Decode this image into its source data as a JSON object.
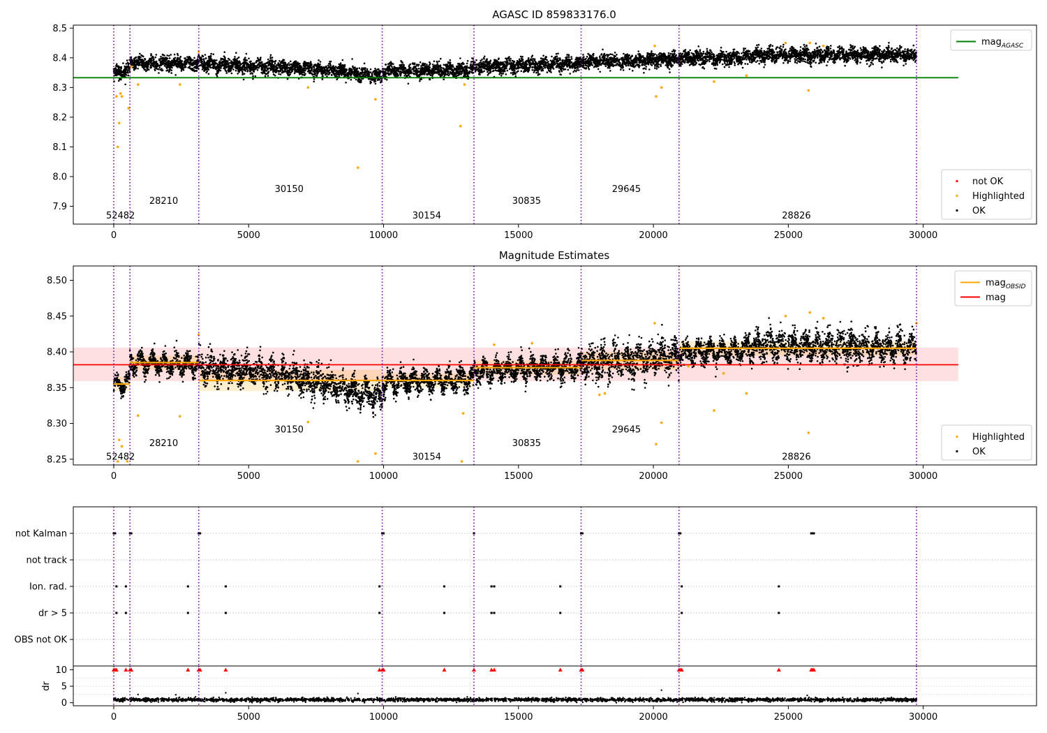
{
  "chart_data": [
    {
      "type": "scatter",
      "title": "AGASC ID 859833176.0",
      "xlabel": "",
      "ylabel": "",
      "xlim": [
        -1500,
        34200
      ],
      "ylim": [
        7.84,
        8.51
      ],
      "xticks": [
        0,
        5000,
        10000,
        15000,
        20000,
        25000,
        30000
      ],
      "yticks": [
        7.9,
        8.0,
        8.1,
        8.2,
        8.3,
        8.4,
        8.5
      ],
      "vlines": [
        0,
        600,
        3150,
        9950,
        13350,
        17320,
        20950,
        29750
      ],
      "obs_labels": [
        {
          "text": "52482",
          "x": 250,
          "y": 7.87
        },
        {
          "text": "28210",
          "x": 1850,
          "y": 7.92
        },
        {
          "text": "30150",
          "x": 6500,
          "y": 7.96
        },
        {
          "text": "30154",
          "x": 11600,
          "y": 7.87
        },
        {
          "text": "30835",
          "x": 15300,
          "y": 7.92
        },
        {
          "text": "29645",
          "x": 19000,
          "y": 7.96
        },
        {
          "text": "28826",
          "x": 25300,
          "y": 7.87
        }
      ],
      "series": [
        {
          "name": "mag_AGASC",
          "kind": "hline",
          "y": 8.333,
          "x_range": [
            -1500,
            31300
          ],
          "color": "#008000"
        },
        {
          "name": "not OK",
          "kind": "points",
          "color": "#ff0000",
          "points": []
        },
        {
          "name": "Highlighted",
          "kind": "points",
          "color": "#ffa500",
          "points": [
            [
              100,
              8.27
            ],
            [
              150,
              8.1
            ],
            [
              200,
              8.18
            ],
            [
              250,
              8.28
            ],
            [
              300,
              8.27
            ],
            [
              550,
              8.23
            ],
            [
              650,
              8.37
            ],
            [
              900,
              8.31
            ],
            [
              2450,
              8.31
            ],
            [
              7200,
              8.3
            ],
            [
              9050,
              8.03
            ],
            [
              9700,
              8.26
            ],
            [
              12850,
              8.17
            ],
            [
              13000,
              8.31
            ],
            [
              20100,
              8.27
            ],
            [
              20300,
              8.3
            ],
            [
              22250,
              8.32
            ],
            [
              23450,
              8.34
            ],
            [
              25750,
              8.29
            ],
            [
              3150,
              8.42
            ],
            [
              20050,
              8.44
            ],
            [
              25800,
              8.45
            ],
            [
              26300,
              8.44
            ],
            [
              24900,
              8.45
            ]
          ]
        },
        {
          "name": "OK",
          "kind": "bands",
          "color": "#000000",
          "segments": [
            {
              "x": [
                0,
                600
              ],
              "y": [
                8.35,
                8.36
              ]
            },
            {
              "x": [
                600,
                3150
              ],
              "y": [
                8.385,
                8.38
              ]
            },
            {
              "x": [
                3150,
                8000
              ],
              "y": [
                8.38,
                8.36
              ]
            },
            {
              "x": [
                8000,
                9950
              ],
              "y": [
                8.36,
                8.335
              ]
            },
            {
              "x": [
                9950,
                13350
              ],
              "y": [
                8.355,
                8.36
              ]
            },
            {
              "x": [
                13350,
                17320
              ],
              "y": [
                8.37,
                8.38
              ]
            },
            {
              "x": [
                17320,
                20950
              ],
              "y": [
                8.385,
                8.395
              ]
            },
            {
              "x": [
                20950,
                23500
              ],
              "y": [
                8.4,
                8.4
              ]
            },
            {
              "x": [
                23500,
                29750
              ],
              "y": [
                8.41,
                8.41
              ]
            }
          ],
          "half_width": 0.025
        }
      ],
      "legends": [
        {
          "position": "top-right",
          "entries": [
            {
              "label": "mag",
              "sub": "AGASC",
              "marker": "line",
              "color": "#008000"
            }
          ]
        },
        {
          "position": "bottom-right",
          "entries": [
            {
              "label": "not OK",
              "marker": "dot",
              "color": "#ff0000"
            },
            {
              "label": "Highlighted",
              "marker": "dot",
              "color": "#ffa500"
            },
            {
              "label": "OK",
              "marker": "dot",
              "color": "#000000"
            }
          ]
        }
      ]
    },
    {
      "type": "scatter",
      "title": "Magnitude Estimates",
      "xlabel": "",
      "ylabel": "",
      "xlim": [
        -1500,
        34200
      ],
      "ylim": [
        8.242,
        8.52
      ],
      "xticks": [
        0,
        5000,
        10000,
        15000,
        20000,
        25000,
        30000
      ],
      "yticks": [
        8.25,
        8.3,
        8.35,
        8.4,
        8.45,
        8.5
      ],
      "vlines": [
        0,
        600,
        3150,
        9950,
        13350,
        17320,
        20950,
        29750
      ],
      "obs_labels": [
        {
          "text": "52482",
          "x": 250,
          "y": 8.254
        },
        {
          "text": "28210",
          "x": 1850,
          "y": 8.273
        },
        {
          "text": "30150",
          "x": 6500,
          "y": 8.292
        },
        {
          "text": "30154",
          "x": 11600,
          "y": 8.254
        },
        {
          "text": "30835",
          "x": 15300,
          "y": 8.273
        },
        {
          "text": "29645",
          "x": 19000,
          "y": 8.292
        },
        {
          "text": "28826",
          "x": 25300,
          "y": 8.254
        }
      ],
      "mag": {
        "value": 8.382,
        "band": [
          8.359,
          8.406
        ],
        "x_range": [
          -1500,
          31300
        ],
        "color": "#ff0000"
      },
      "mag_obsid": [
        {
          "x": [
            0,
            600
          ],
          "value": 8.355,
          "band": [
            8.345,
            8.365
          ]
        },
        {
          "x": [
            600,
            3150
          ],
          "value": 8.385,
          "band": [
            8.375,
            8.395
          ]
        },
        {
          "x": [
            3150,
            9950
          ],
          "value": 8.36,
          "band": [
            8.345,
            8.375
          ]
        },
        {
          "x": [
            9950,
            13350
          ],
          "value": 8.36,
          "band": [
            8.35,
            8.37
          ]
        },
        {
          "x": [
            13350,
            17320
          ],
          "value": 8.378,
          "band": [
            8.368,
            8.388
          ]
        },
        {
          "x": [
            17320,
            20950
          ],
          "value": 8.388,
          "band": [
            8.375,
            8.4
          ]
        },
        {
          "x": [
            20950,
            29750
          ],
          "value": 8.405,
          "band": [
            8.395,
            8.415
          ]
        }
      ],
      "ok_segments": [
        {
          "x": [
            0,
            600
          ],
          "y": [
            8.352,
            8.357
          ],
          "hw": 0.012
        },
        {
          "x": [
            600,
            3150
          ],
          "y": [
            8.385,
            8.382
          ],
          "hw": 0.014
        },
        {
          "x": [
            3150,
            6000
          ],
          "y": [
            8.378,
            8.37
          ],
          "hw": 0.02
        },
        {
          "x": [
            6000,
            8000
          ],
          "y": [
            8.37,
            8.355
          ],
          "hw": 0.022
        },
        {
          "x": [
            8000,
            9950
          ],
          "y": [
            8.355,
            8.335
          ],
          "hw": 0.02
        },
        {
          "x": [
            9950,
            13350
          ],
          "y": [
            8.357,
            8.362
          ],
          "hw": 0.016
        },
        {
          "x": [
            13350,
            17320
          ],
          "y": [
            8.372,
            8.38
          ],
          "hw": 0.016
        },
        {
          "x": [
            17320,
            20950
          ],
          "y": [
            8.382,
            8.395
          ],
          "hw": 0.025
        },
        {
          "x": [
            20950,
            23500
          ],
          "y": [
            8.4,
            8.402
          ],
          "hw": 0.016
        },
        {
          "x": [
            23500,
            29750
          ],
          "y": [
            8.408,
            8.406
          ],
          "hw": 0.022
        }
      ],
      "highlighted_points": [
        [
          900,
          8.311
        ],
        [
          2450,
          8.31
        ],
        [
          7200,
          8.302
        ],
        [
          9700,
          8.258
        ],
        [
          12950,
          8.314
        ],
        [
          20100,
          8.271
        ],
        [
          20300,
          8.301
        ],
        [
          22250,
          8.318
        ],
        [
          23450,
          8.342
        ],
        [
          25750,
          8.287
        ],
        [
          3150,
          8.424
        ],
        [
          20050,
          8.44
        ],
        [
          25800,
          8.455
        ],
        [
          26300,
          8.447
        ],
        [
          14100,
          8.41
        ],
        [
          15500,
          8.412
        ],
        [
          24900,
          8.45
        ],
        [
          29750,
          8.44
        ],
        [
          18200,
          8.342
        ],
        [
          18000,
          8.34
        ],
        [
          21300,
          8.38
        ],
        [
          22600,
          8.37
        ],
        [
          200,
          8.277
        ],
        [
          300,
          8.268
        ],
        [
          9050,
          8.247
        ],
        [
          12900,
          8.247
        ],
        [
          150,
          8.247
        ],
        [
          500,
          8.247
        ]
      ],
      "legends": [
        {
          "position": "top-right",
          "entries": [
            {
              "label": "mag",
              "sub": "OBSID",
              "marker": "line",
              "color": "#ffa500"
            },
            {
              "label": "mag",
              "sub": "",
              "marker": "line",
              "color": "#ff0000"
            }
          ]
        },
        {
          "position": "bottom-right",
          "entries": [
            {
              "label": "Highlighted",
              "marker": "dot",
              "color": "#ffa500"
            },
            {
              "label": "OK",
              "marker": "dot",
              "color": "#000000"
            }
          ]
        }
      ]
    },
    {
      "type": "scatter",
      "title": "",
      "xlabel": "",
      "ylabel": "",
      "xlim": [
        -1500,
        34200
      ],
      "xticks": [
        0,
        5000,
        10000,
        15000,
        20000,
        25000,
        30000
      ],
      "vlines": [
        0,
        600,
        3150,
        9950,
        13350,
        17320,
        20950,
        29750
      ],
      "flag_rows": [
        "not Kalman",
        "not track",
        "Ion. rad.",
        "dr > 5",
        "OBS not OK"
      ],
      "flags": {
        "not Kalman": [
          0,
          50,
          600,
          650,
          3150,
          3200,
          9950,
          10000,
          13350,
          17320,
          17370,
          20950,
          21000,
          25850,
          25900,
          25950
        ],
        "not track": [],
        "Ion. rad.": [
          100,
          450,
          2750,
          4150,
          9850,
          12250,
          14000,
          14100,
          16550,
          21050,
          24650
        ],
        "dr > 5": [
          100,
          450,
          2750,
          4150,
          9850,
          12250,
          14000,
          14100,
          16550,
          21050,
          24650
        ],
        "OBS not OK": []
      }
    },
    {
      "type": "scatter",
      "title": "",
      "xlabel": "",
      "ylabel": "dr",
      "xlim": [
        -1500,
        34200
      ],
      "ylim": [
        -0.5,
        10.5
      ],
      "yticks": [
        0,
        5,
        10
      ],
      "xticks": [
        0,
        5000,
        10000,
        15000,
        20000,
        25000,
        30000
      ],
      "xtick_labels": [
        "0",
        "5000",
        "10000",
        "15000",
        "20000",
        "25000",
        "30000"
      ],
      "vlines": [
        0,
        600,
        3150,
        9950,
        13350,
        17320,
        20950,
        29750
      ],
      "clipped_points_at_10": [
        0,
        50,
        100,
        450,
        600,
        650,
        2750,
        3150,
        3200,
        4150,
        9850,
        9950,
        10000,
        12250,
        13350,
        14000,
        14100,
        16550,
        17320,
        17370,
        20950,
        21000,
        21050,
        24650,
        25850,
        25900,
        25950
      ],
      "outliers": [
        [
          900,
          2.5
        ],
        [
          2300,
          2.4
        ],
        [
          4150,
          3.0
        ],
        [
          9050,
          2.8
        ],
        [
          20300,
          3.8
        ],
        [
          25700,
          2.2
        ]
      ],
      "baseline": {
        "mean": 0.9,
        "spread": 0.7
      }
    }
  ]
}
